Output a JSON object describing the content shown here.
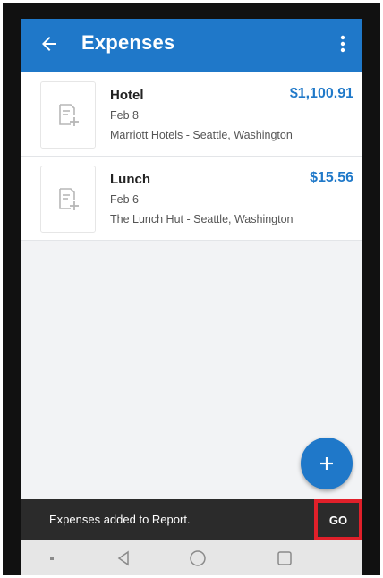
{
  "header": {
    "title": "Expenses",
    "icons": {
      "back": "back-arrow-icon",
      "more": "more-vert-icon"
    }
  },
  "expenses": [
    {
      "name": "Hotel",
      "amount": "$1,100.91",
      "date": "Feb 8",
      "merchant": "Marriott Hotels - Seattle, Washington",
      "thumb_icon": "add-receipt-icon"
    },
    {
      "name": "Lunch",
      "amount": "$15.56",
      "date": "Feb 6",
      "merchant": "The Lunch Hut - Seattle, Washington",
      "thumb_icon": "add-receipt-icon"
    }
  ],
  "fab": {
    "icon": "plus-icon"
  },
  "snackbar": {
    "message": "Expenses added to Report.",
    "action_label": "GO"
  },
  "nav": {
    "icons": [
      "recents-dot-icon",
      "back-triangle-icon",
      "home-circle-icon",
      "overview-square-icon"
    ]
  },
  "colors": {
    "primary": "#1f78c9",
    "amount": "#2079c9",
    "snackbar": "#2b2b2b",
    "highlight": "#e0202a",
    "background": "#f2f3f5"
  }
}
